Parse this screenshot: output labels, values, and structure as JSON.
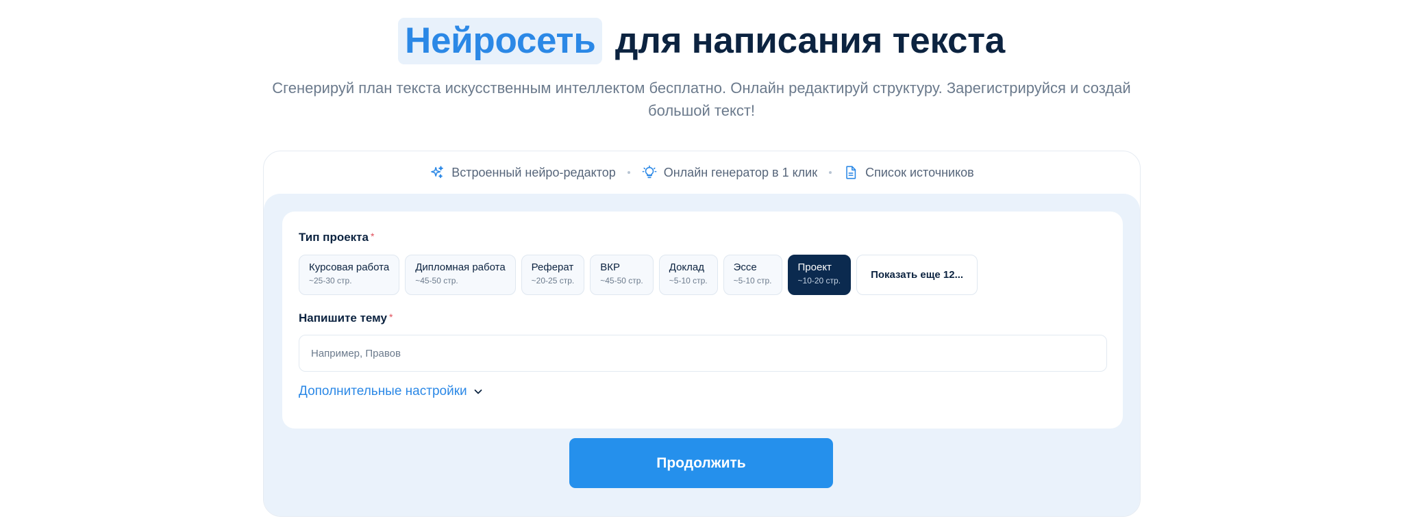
{
  "hero": {
    "title_accent": "Нейросеть",
    "title_rest": "для написания текста",
    "subtitle": "Сгенерируй план текста искусственным интеллектом бесплатно. Онлайн редактируй структуру. Зарегистрируйся и создай большой текст!"
  },
  "features": [
    {
      "label": "Встроенный нейро-редактор",
      "icon": "sparkles-icon"
    },
    {
      "label": "Онлайн генератор в 1 клик",
      "icon": "lightbulb-icon"
    },
    {
      "label": "Список источников",
      "icon": "document-icon"
    }
  ],
  "form": {
    "project_type_label": "Тип проекта",
    "required_mark": "*",
    "project_types": [
      {
        "name": "Курсовая работа",
        "pages": "~25-30 стр.",
        "selected": false
      },
      {
        "name": "Дипломная работа",
        "pages": "~45-50 стр.",
        "selected": false
      },
      {
        "name": "Реферат",
        "pages": "~20-25 стр.",
        "selected": false
      },
      {
        "name": "ВКР",
        "pages": "~45-50 стр.",
        "selected": false
      },
      {
        "name": "Доклад",
        "pages": "~5-10 стр.",
        "selected": false
      },
      {
        "name": "Эссе",
        "pages": "~5-10 стр.",
        "selected": false
      },
      {
        "name": "Проект",
        "pages": "~10-20 стр.",
        "selected": true
      }
    ],
    "show_more_label": "Показать еще 12...",
    "topic_label": "Напишите тему",
    "topic_value": "",
    "topic_placeholder": "Например, Правов",
    "advanced_label": "Дополнительные настройки",
    "continue_label": "Продолжить"
  },
  "colors": {
    "accent": "#2b88e6",
    "accent_bg": "#e8f1fb",
    "dark": "#0c2340",
    "selected_chip": "#0b2a4f",
    "button": "#2590ec",
    "panel_bg": "#eaf2fb",
    "required": "#e04e5a"
  }
}
